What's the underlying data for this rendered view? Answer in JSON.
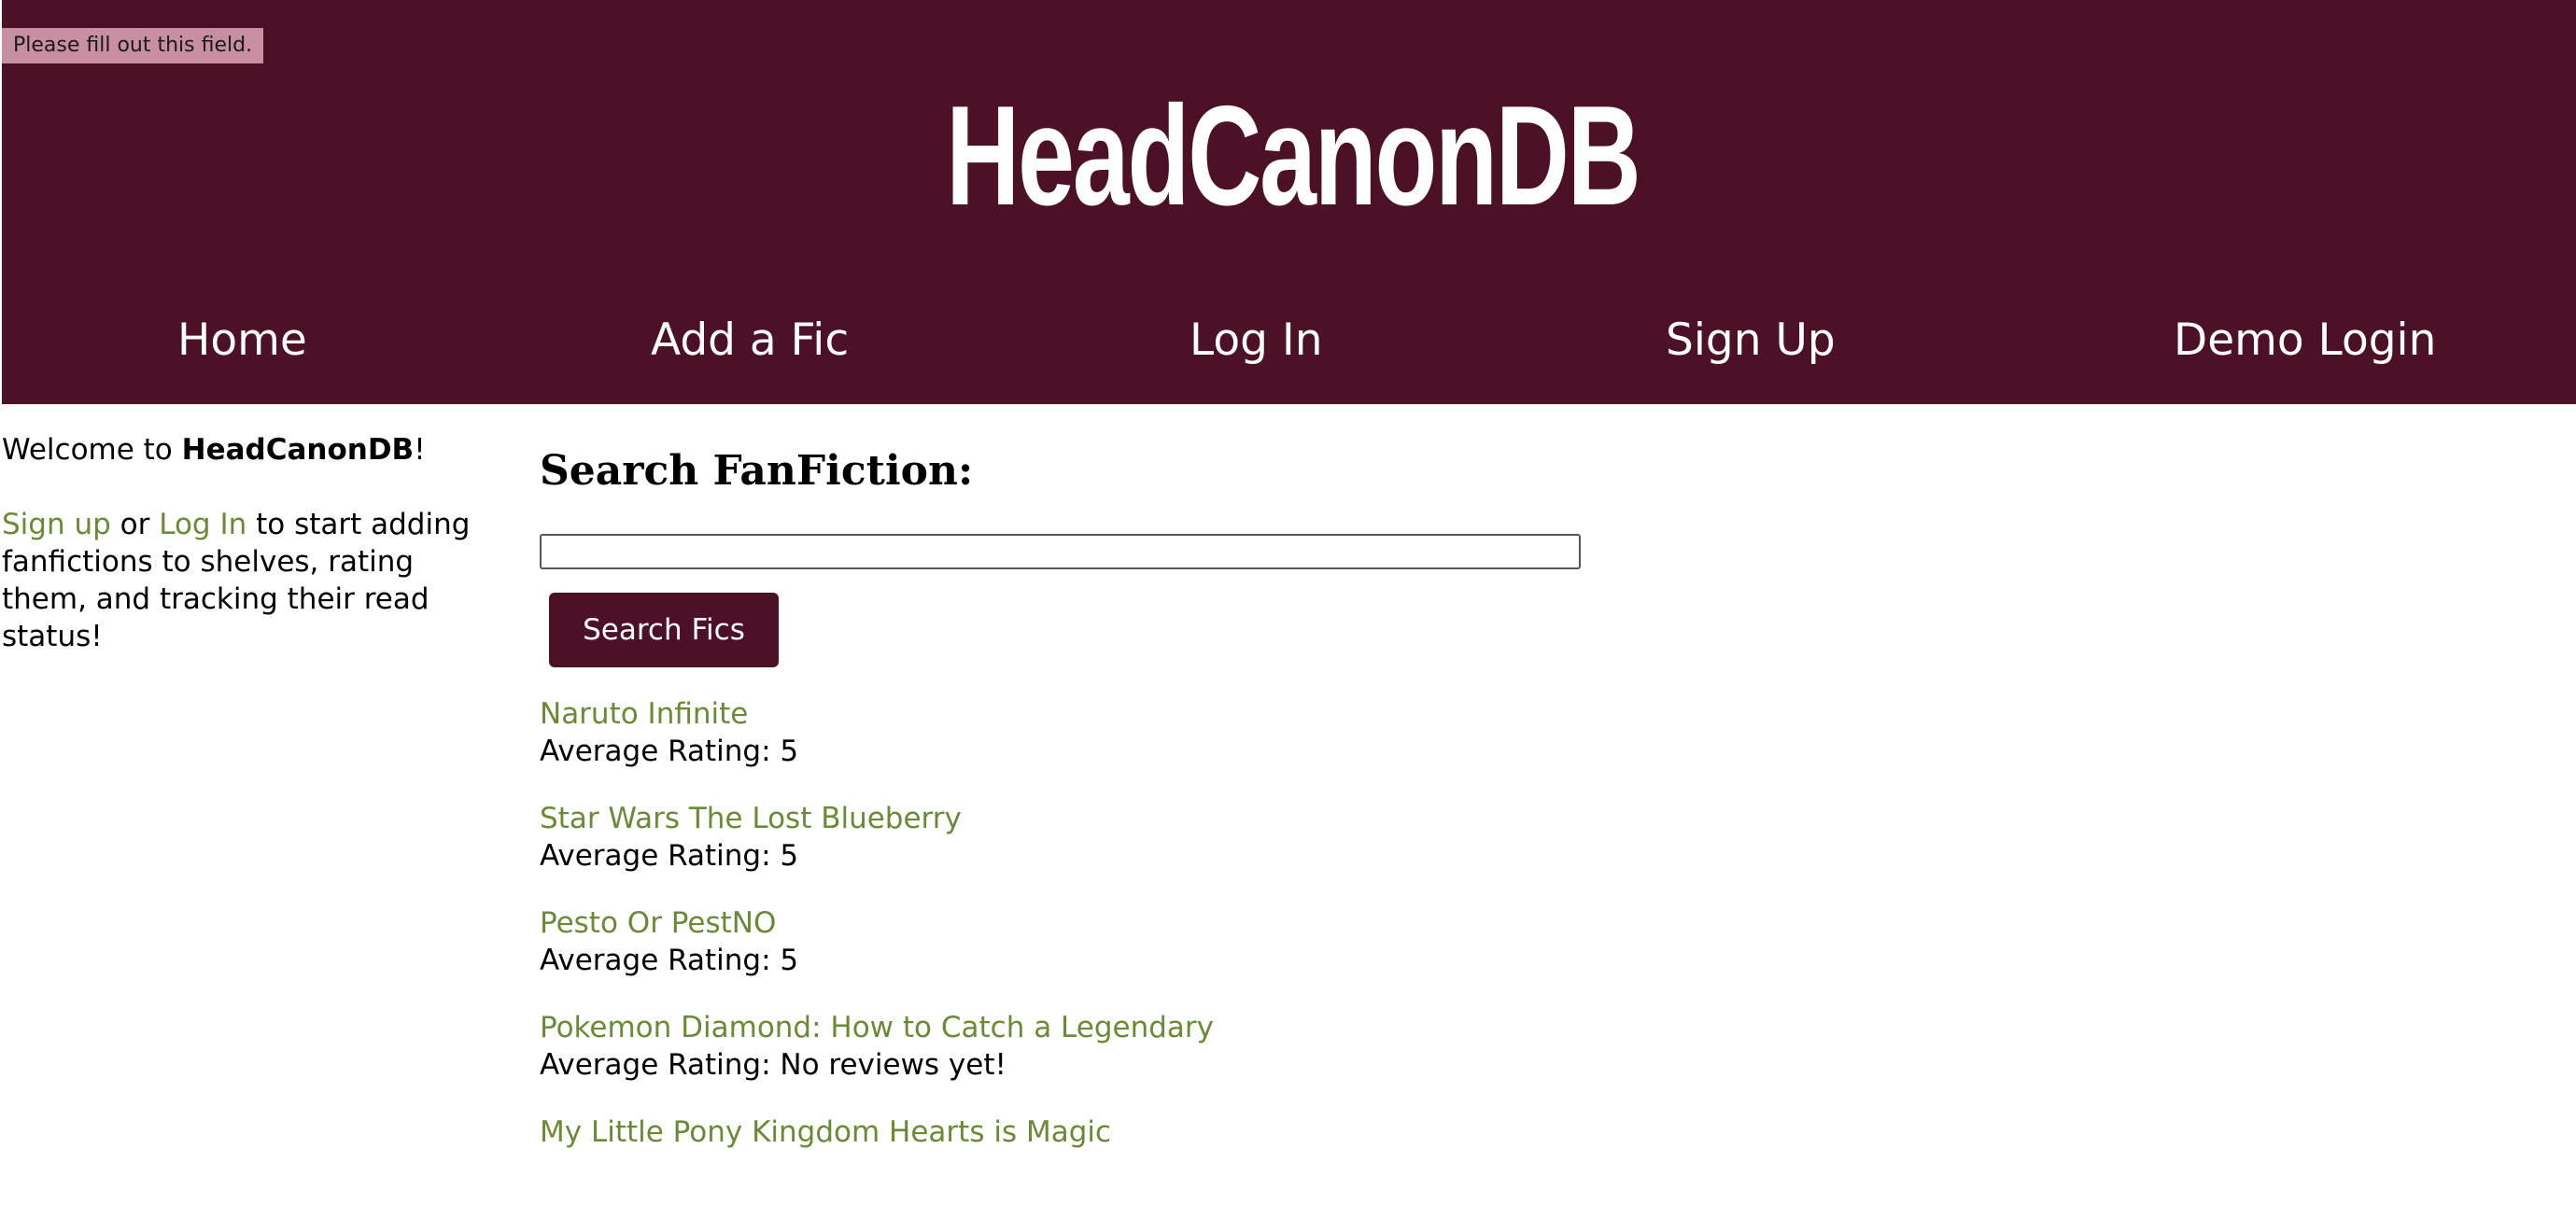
{
  "tooltip": "Please fill out this field.",
  "header": {
    "title": "HeadCanonDB"
  },
  "nav": {
    "home": "Home",
    "add_fic": "Add a Fic",
    "log_in": "Log In",
    "sign_up": "Sign Up",
    "demo_login": "Demo Login"
  },
  "sidebar": {
    "welcome_prefix": "Welcome to ",
    "welcome_brand": "HeadCanonDB",
    "welcome_suffix": "!",
    "signup_link": "Sign up",
    "or_text": " or ",
    "login_link": "Log In",
    "cta_text": " to start adding fanfictions to shelves, rating them, and tracking their read status!"
  },
  "search": {
    "heading": "Search FanFiction:",
    "input_value": "",
    "button_label": "Search Fics"
  },
  "results": [
    {
      "title": "Naruto Infinite",
      "rating": "Average Rating: 5"
    },
    {
      "title": "Star Wars The Lost Blueberry",
      "rating": "Average Rating: 5"
    },
    {
      "title": "Pesto Or PestNO",
      "rating": "Average Rating: 5"
    },
    {
      "title": "Pokemon Diamond: How to Catch a Legendary",
      "rating": "Average Rating: No reviews yet!"
    },
    {
      "title": "My Little Pony Kingdom Hearts is Magic",
      "rating": ""
    }
  ],
  "colors": {
    "brand": "#4c1027",
    "link": "#6b8a35",
    "tooltip_bg": "#c88fa2"
  }
}
